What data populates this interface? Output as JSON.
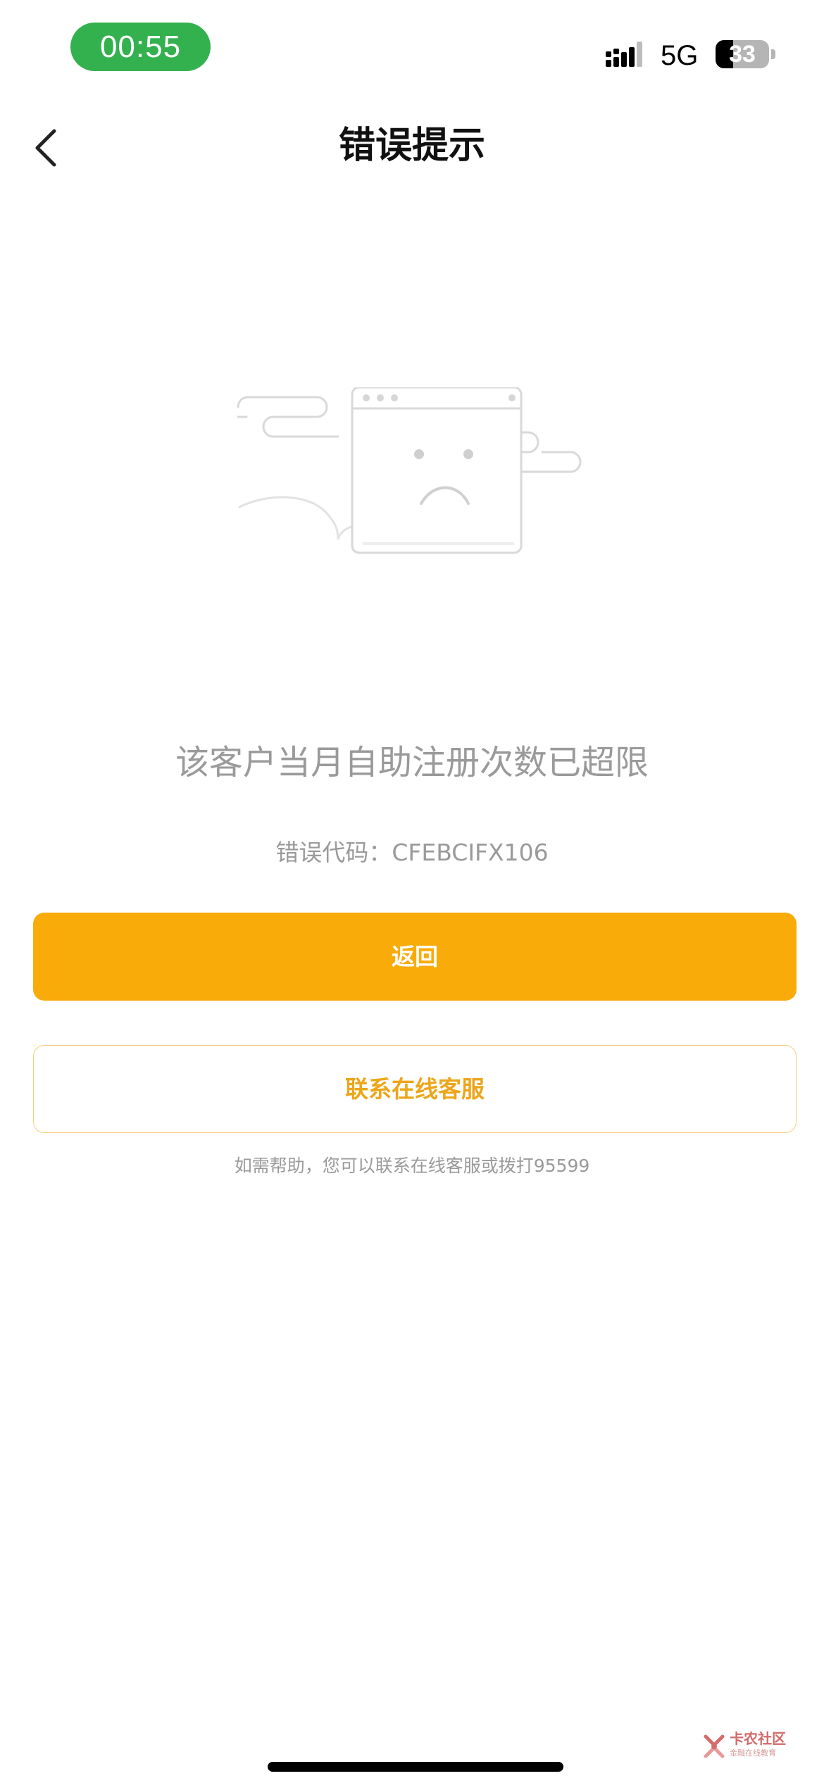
{
  "status_bar": {
    "time": "00:55",
    "network": "5G",
    "battery_level": "33",
    "battery_fraction": 0.33,
    "icons": [
      "signal-icon",
      "battery-icon"
    ]
  },
  "nav": {
    "back_icon": "chevron-left-icon",
    "title": "错误提示"
  },
  "error": {
    "illustration_icon": "sad-browser-window-icon",
    "message": "该客户当月自助注册次数已超限",
    "code": "错误代码：CFEBCIFX106"
  },
  "actions": {
    "return_label": "返回",
    "support_label": "联系在线客服",
    "help_text": "如需帮助，您可以联系在线客服或拨打95599"
  },
  "watermark": {
    "name": "卡农社区",
    "subtitle": "金融在线教育"
  },
  "colors": {
    "primary": "#f9ab0a",
    "primary_text": "#eca61b",
    "secondary_text": "#9a9a9a",
    "time_pill": "#34b14f"
  }
}
